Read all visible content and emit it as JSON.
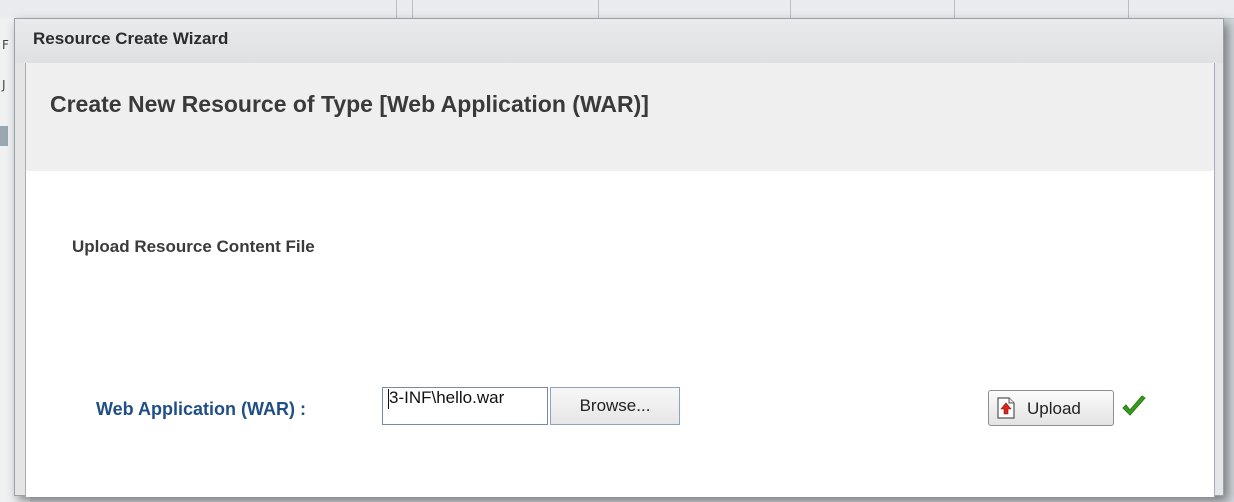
{
  "background": {
    "left_letters": [
      "F",
      "J"
    ]
  },
  "dialog": {
    "title": "Resource Create Wizard",
    "heading": "Create New Resource of Type [Web Application (WAR)]",
    "section_title": "Upload Resource Content File",
    "field": {
      "label": "Web Application (WAR) :",
      "value": "3-INF\\hello.war"
    },
    "browse_label": "Browse...",
    "upload_label": "Upload",
    "upload_icon": "upload-file-icon",
    "status_icon": "checkmark-icon"
  },
  "colors": {
    "label_blue": "#1f4f86",
    "check_green": "#3a9a1e"
  }
}
